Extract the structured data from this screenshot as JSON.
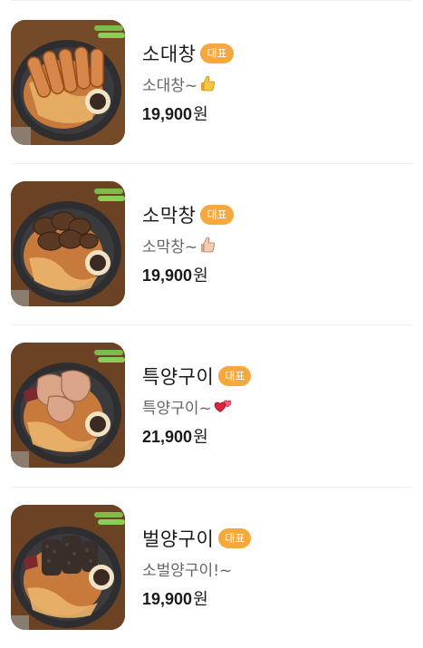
{
  "menu": {
    "items": [
      {
        "name": "소대창",
        "badge": "대표",
        "description": "소대창~",
        "emoji": "thumbs-up-icon",
        "price": "19,900",
        "currency": "원"
      },
      {
        "name": "소막창",
        "badge": "대표",
        "description": "소막창~",
        "emoji": "thumbs-up-light-icon",
        "price": "19,900",
        "currency": "원"
      },
      {
        "name": "특양구이",
        "badge": "대표",
        "description": "특양구이~",
        "emoji": "two-hearts-icon",
        "price": "21,900",
        "currency": "원"
      },
      {
        "name": "벌양구이",
        "badge": "대표",
        "description": "소벌양구이!~",
        "emoji": "",
        "price": "19,900",
        "currency": "원"
      }
    ]
  },
  "colors": {
    "badge": "#f7a83c",
    "divider": "#efefef",
    "title_text": "#1a1a1a",
    "desc_text": "#666666"
  }
}
